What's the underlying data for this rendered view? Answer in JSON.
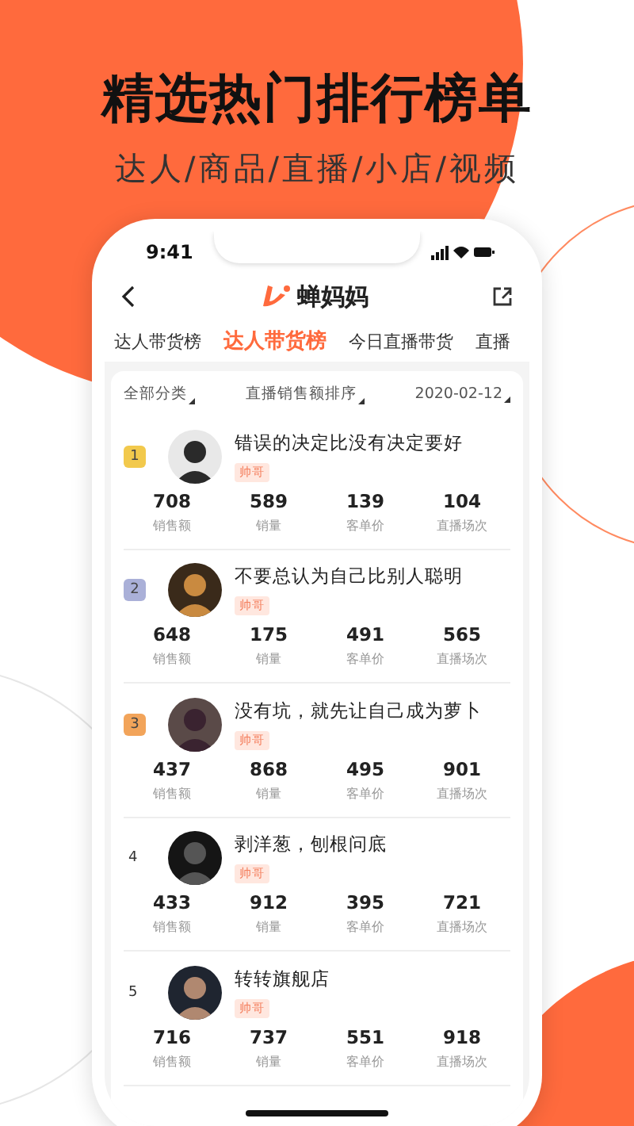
{
  "headline": "精选热门排行榜单",
  "subheadline": "达人/商品/直播/小店/视频",
  "status_bar": {
    "time": "9:41"
  },
  "nav": {
    "title": "蝉妈妈"
  },
  "tabs": [
    {
      "label": "达人带货榜",
      "selected": false
    },
    {
      "label": "达人带货榜",
      "selected": true
    },
    {
      "label": "今日直播带货",
      "selected": false
    },
    {
      "label": "直播",
      "selected": false
    }
  ],
  "filters": [
    "全部分类",
    "直播销售额排序",
    "2020-02-12"
  ],
  "rows": [
    {
      "rank": "1",
      "kind": "medal",
      "color": "#f2c94c",
      "name": "错误的决定比没有决定要好",
      "tag": "帅哥",
      "stats": [
        {
          "value": "708",
          "label": "销售额"
        },
        {
          "value": "589",
          "label": "销量"
        },
        {
          "value": "139",
          "label": "客单价"
        },
        {
          "value": "104",
          "label": "直播场次"
        }
      ]
    },
    {
      "rank": "2",
      "kind": "medal",
      "color": "#aab0d8",
      "name": "不要总认为自己比别人聪明",
      "tag": "帅哥",
      "stats": [
        {
          "value": "648",
          "label": "销售额"
        },
        {
          "value": "175",
          "label": "销量"
        },
        {
          "value": "491",
          "label": "客单价"
        },
        {
          "value": "565",
          "label": "直播场次"
        }
      ]
    },
    {
      "rank": "3",
      "kind": "medal",
      "color": "#f2a45a",
      "name": "没有坑，就先让自己成为萝卜",
      "tag": "帅哥",
      "stats": [
        {
          "value": "437",
          "label": "销售额"
        },
        {
          "value": "868",
          "label": "销量"
        },
        {
          "value": "495",
          "label": "客单价"
        },
        {
          "value": "901",
          "label": "直播场次"
        }
      ]
    },
    {
      "rank": "4",
      "kind": "plain",
      "name": "剥洋葱，刨根问底",
      "tag": "帅哥",
      "stats": [
        {
          "value": "433",
          "label": "销售额"
        },
        {
          "value": "912",
          "label": "销量"
        },
        {
          "value": "395",
          "label": "客单价"
        },
        {
          "value": "721",
          "label": "直播场次"
        }
      ]
    },
    {
      "rank": "5",
      "kind": "plain",
      "name": "转转旗舰店",
      "tag": "帅哥",
      "stats": [
        {
          "value": "716",
          "label": "销售额"
        },
        {
          "value": "737",
          "label": "销量"
        },
        {
          "value": "551",
          "label": "客单价"
        },
        {
          "value": "918",
          "label": "直播场次"
        }
      ]
    }
  ]
}
